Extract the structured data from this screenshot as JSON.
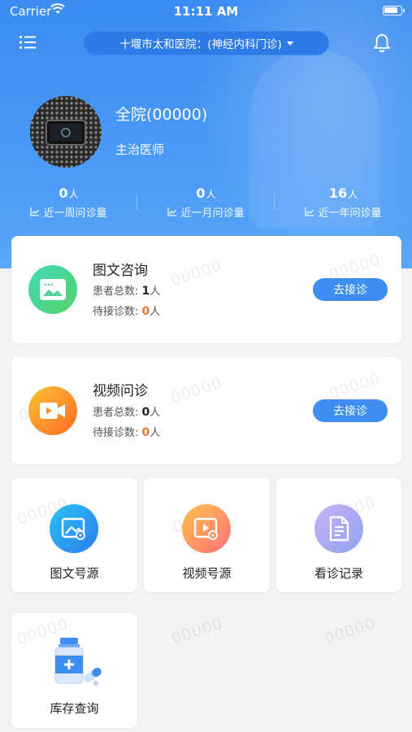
{
  "status_bar": {
    "carrier": "Carrier",
    "time": "11:11 AM"
  },
  "header": {
    "hospital": "十堰市太和医院：(神经内科门诊)",
    "doctor_name": "全院(00000)",
    "doctor_title": "主治医师"
  },
  "stats": [
    {
      "value": "0",
      "unit": "人",
      "label": "近一周问诊量"
    },
    {
      "value": "0",
      "unit": "人",
      "label": "近一月问诊量"
    },
    {
      "value": "16",
      "unit": "人",
      "label": "近一年问诊量"
    }
  ],
  "services": [
    {
      "title": "图文咨询",
      "total_label": "患者总数: ",
      "total": "1",
      "total_unit": "人",
      "pending_label": "待接诊数: ",
      "pending": "0",
      "pending_unit": "人",
      "button": "去接诊",
      "icon": "image-chat-icon"
    },
    {
      "title": "视频问诊",
      "total_label": "患者总数: ",
      "total": "0",
      "total_unit": "人",
      "pending_label": "待接诊数: ",
      "pending": "0",
      "pending_unit": "人",
      "button": "去接诊",
      "icon": "video-call-icon"
    }
  ],
  "tiles": [
    {
      "label": "图文号源",
      "icon": "image-source-icon"
    },
    {
      "label": "视频号源",
      "icon": "video-source-icon"
    },
    {
      "label": "看诊记录",
      "icon": "record-icon"
    },
    {
      "label": "库存查询",
      "icon": "medicine-bottle-icon"
    }
  ],
  "watermark": "00000",
  "colors": {
    "primary": "#3d8ef0",
    "highlight": "#f5742a"
  }
}
